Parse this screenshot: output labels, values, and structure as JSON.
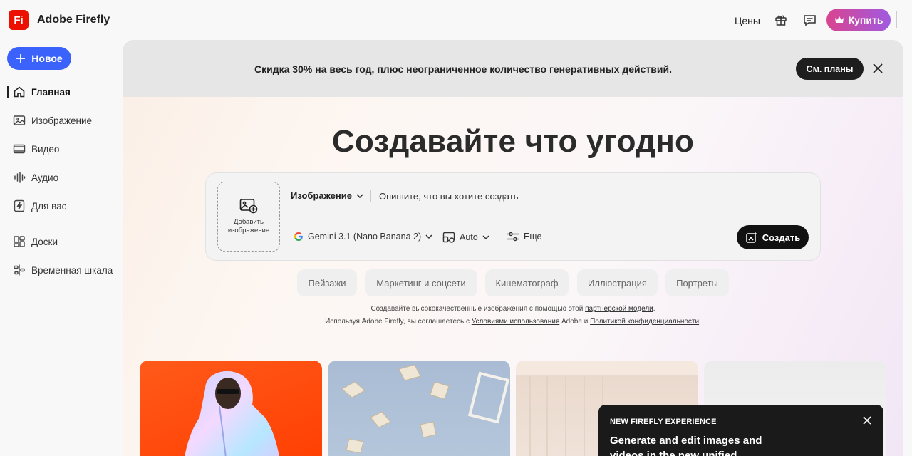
{
  "app": {
    "logo": "Fi",
    "name": "Adobe Firefly"
  },
  "topbar": {
    "prices": "Цены",
    "buy": "Купить"
  },
  "sidebar": {
    "new": "Новое",
    "items": [
      {
        "label": "Главная",
        "icon": "home-icon"
      },
      {
        "label": "Изображение",
        "icon": "image-icon"
      },
      {
        "label": "Видео",
        "icon": "video-icon"
      },
      {
        "label": "Аудио",
        "icon": "audio-icon"
      },
      {
        "label": "Для вас",
        "icon": "bolt-icon"
      },
      {
        "label": "Доски",
        "icon": "boards-icon"
      },
      {
        "label": "Временная шкала",
        "icon": "timeline-icon"
      }
    ]
  },
  "banner": {
    "text": "Скидка 30% на весь год, плюс неограниченное количество генеративных действий.",
    "plans": "См. планы"
  },
  "hero": {
    "title": "Создавайте что угодно"
  },
  "prompt": {
    "add_line1": "Добавить",
    "add_line2": "изображение",
    "mode": "Изображение",
    "placeholder": "Опишите, что вы хотите создать",
    "model": "Gemini 3.1 (Nano Banana 2)",
    "aspect": "Auto",
    "more": "Еще",
    "create": "Создать"
  },
  "chips": [
    "Пейзажи",
    "Маркетинг и соцсети",
    "Кинематограф",
    "Иллюстрация",
    "Портреты"
  ],
  "legal": {
    "line1_pre": "Создавайте высококачественные изображения с помощью этой ",
    "line1_link": "партнерской модели",
    "line1_post": ".",
    "line2_pre": "Используя Adobe Firefly, вы соглашаетесь с ",
    "line2_link1": "Условиями использования",
    "line2_mid": " Adobe и ",
    "line2_link2": "Политикой конфиденциальности",
    "line2_post": "."
  },
  "toast": {
    "kicker": "NEW FIREFLY EXPERIENCE",
    "title": "Generate and edit images and videos in the new unified"
  },
  "colors": {
    "accent": "#3b63fb",
    "brand": "#eb1000",
    "dark": "#111111"
  }
}
